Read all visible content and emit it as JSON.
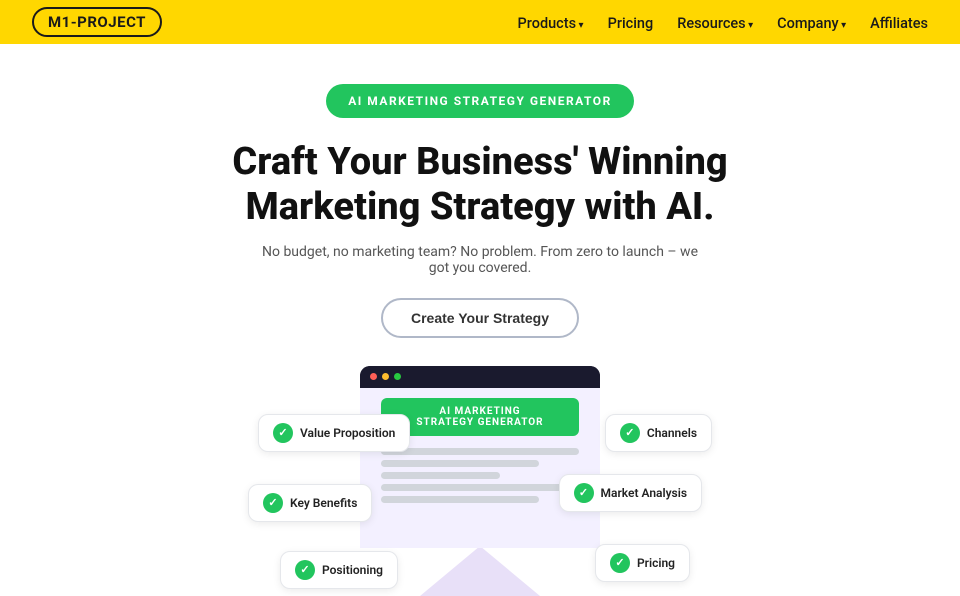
{
  "nav": {
    "logo": "M1-PROJECT",
    "links": [
      {
        "label": "Products",
        "dropdown": true
      },
      {
        "label": "Pricing",
        "dropdown": false
      },
      {
        "label": "Resources",
        "dropdown": true
      },
      {
        "label": "Company",
        "dropdown": true
      },
      {
        "label": "Affiliates",
        "dropdown": false
      }
    ]
  },
  "hero": {
    "badge": "AI MARKETING STRATEGY GENERATOR",
    "title_line1": "Craft Your Business' Winning",
    "title_line2": "Marketing Strategy with AI.",
    "subtitle": "No budget, no marketing team? No problem. From zero to launch – we got you covered.",
    "cta_label": "Create Your Strategy"
  },
  "illustration": {
    "browser_badge_line1": "AI MARKETING",
    "browser_badge_line2": "STRATEGY GENERATOR",
    "cards": [
      {
        "id": "value-prop",
        "label": "Value Proposition"
      },
      {
        "id": "channels",
        "label": "Channels"
      },
      {
        "id": "key-benefits",
        "label": "Key Benefits"
      },
      {
        "id": "market-analysis",
        "label": "Market Analysis"
      },
      {
        "id": "pricing",
        "label": "Pricing"
      },
      {
        "id": "positioning",
        "label": "Positioning"
      }
    ]
  }
}
